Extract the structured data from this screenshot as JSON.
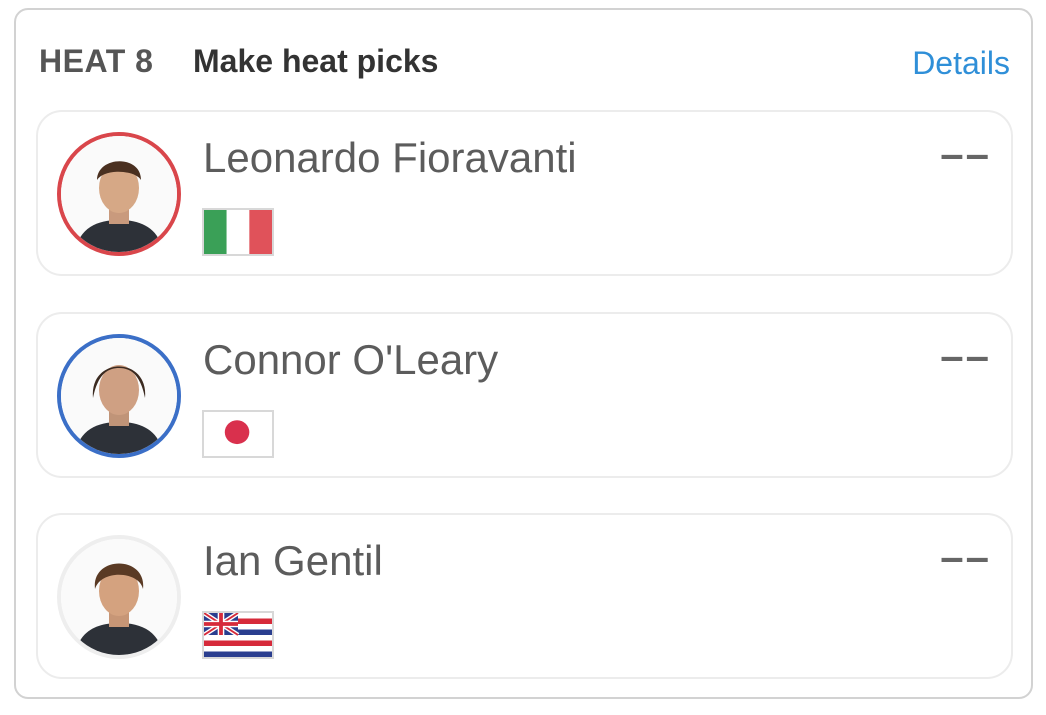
{
  "header": {
    "heat_label": "HEAT 8",
    "title": "Make heat picks",
    "details_label": "Details"
  },
  "colors": {
    "details_link": "#2f8fd8",
    "ring_red": "#d9464b",
    "ring_blue": "#3b6fc7",
    "ring_none": "#eeeeee"
  },
  "surfers": [
    {
      "name": "Leonardo Fioravanti",
      "result": "––",
      "flag": "italy-flag-icon",
      "ring_color": "#d9464b"
    },
    {
      "name": "Connor O'Leary",
      "result": "––",
      "flag": "japan-flag-icon",
      "ring_color": "#3b6fc7"
    },
    {
      "name": "Ian Gentil",
      "result": "––",
      "flag": "hawaii-flag-icon",
      "ring_color": "#eeeeee"
    }
  ]
}
